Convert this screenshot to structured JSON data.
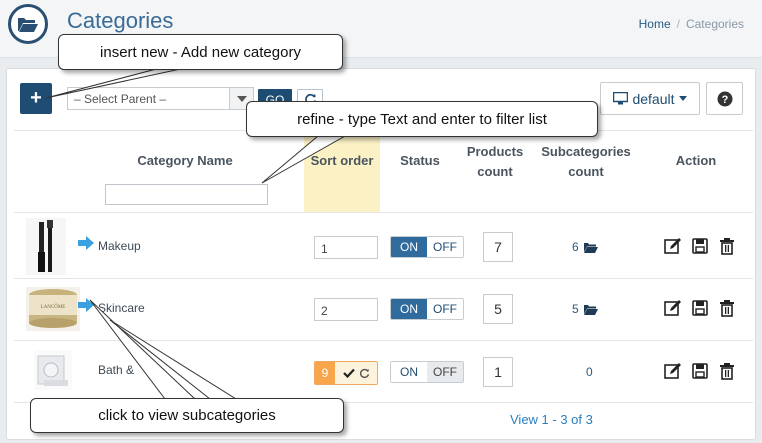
{
  "header": {
    "title": "Categories",
    "breadcrumb_home": "Home",
    "breadcrumb_sep": "/",
    "breadcrumb_current": "Categories",
    "icon": "folder-open-icon"
  },
  "toolbar": {
    "add_label": "+",
    "select_parent_value": "– Select Parent –",
    "go_label": "GO",
    "view_label": "default",
    "view_icon": "monitor-icon",
    "help_icon": "question-circle-icon"
  },
  "table": {
    "columns": {
      "name": "Category Name",
      "sort": "Sort order",
      "status": "Status",
      "products": [
        "Products",
        "count"
      ],
      "subcats": [
        "Subcategories",
        "count"
      ],
      "action": "Action"
    },
    "rows": [
      {
        "name": "Makeup",
        "sort": "1",
        "on": "ON",
        "off": "OFF",
        "status": "on",
        "products": "7",
        "subcategories": "6",
        "has_children": true
      },
      {
        "name": "Skincare",
        "sort": "2",
        "on": "ON",
        "off": "OFF",
        "status": "on",
        "products": "5",
        "subcategories": "5",
        "has_children": true
      },
      {
        "name": "Bath &",
        "sort": "9",
        "on": "ON",
        "off": "OFF",
        "status": "off",
        "products": "1",
        "subcategories": "0",
        "has_children": false
      }
    ]
  },
  "pager": {
    "text": "View 1 - 3 of 3"
  },
  "callouts": {
    "insert": "insert new - Add new category",
    "refine": "refine - type Text and enter to filter list",
    "subcats": "click to view subcategories"
  },
  "colors": {
    "primary": "#1f4c72",
    "title": "#3a6a96",
    "accent_sort": "#fbf1c4",
    "edit_orange": "#f7a64c",
    "link": "#2a7fc0"
  }
}
